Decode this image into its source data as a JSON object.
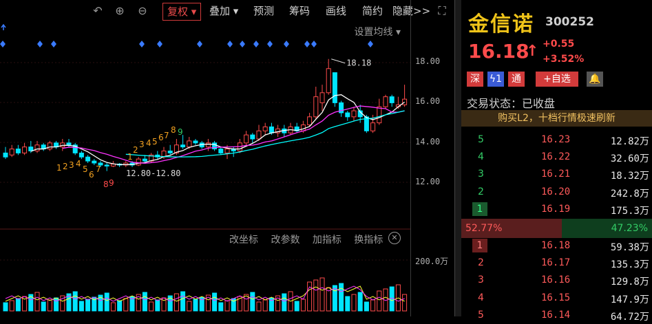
{
  "toolbar": {
    "undo_icon": "undo-icon",
    "zoom_in_icon": "zoom-in-icon",
    "zoom_out_icon": "zoom-out-icon",
    "items": [
      "复权 ▾",
      "叠加 ▾",
      "预测",
      "筹码",
      "画线",
      "简约",
      "隐藏>>"
    ],
    "fullscreen_icon": "fullscreen-icon"
  },
  "main_chart": {
    "settings_label": "设置均线 ▾",
    "annotation_high": "18.18",
    "annotation_low": "12.80-12.80",
    "price_axis": [
      "18.00",
      "16.00",
      "14.00",
      "12.00"
    ],
    "td_down": [
      "1",
      "2",
      "3",
      "4",
      "5",
      "6",
      "7",
      "8",
      "9"
    ],
    "td_up": [
      "1",
      "2",
      "3",
      "4",
      "5",
      "6",
      "7",
      "8",
      "9"
    ]
  },
  "sub_chart": {
    "tools": [
      "改坐标",
      "改参数",
      "加指标",
      "换指标"
    ],
    "close_icon": "close-icon",
    "axis_label": "200.0万"
  },
  "quote": {
    "name": "金信诺",
    "code": "300252",
    "price": "16.18",
    "arrow": "↑",
    "change": "+0.55",
    "change_pct": "+3.52%",
    "badges": [
      "深",
      "ϟ1",
      "通",
      "+自选"
    ],
    "bell_icon": "bell-icon",
    "trade_status": "交易状态：已收盘",
    "l2_banner": "购买L2，十档行情极速刷新",
    "asks": [
      {
        "level": "5",
        "price": "16.23",
        "volume": "12.82万"
      },
      {
        "level": "4",
        "price": "16.22",
        "volume": "32.60万"
      },
      {
        "level": "3",
        "price": "16.21",
        "volume": "18.32万"
      },
      {
        "level": "2",
        "price": "16.20",
        "volume": "242.8万"
      },
      {
        "level": "1",
        "price": "16.19",
        "volume": "175.3万"
      }
    ],
    "buy_ratio": "52.77%",
    "sell_ratio": "47.23%",
    "bids": [
      {
        "level": "1",
        "price": "16.18",
        "volume": "59.38万"
      },
      {
        "level": "2",
        "price": "16.17",
        "volume": "135.3万"
      },
      {
        "level": "3",
        "price": "16.16",
        "volume": "129.8万"
      },
      {
        "level": "4",
        "price": "16.15",
        "volume": "147.9万"
      },
      {
        "level": "5",
        "price": "16.14",
        "volume": "64.72万"
      }
    ]
  },
  "colors": {
    "up": "#ff4b4b",
    "down": "#00e5ff",
    "ma5": "#ffffff",
    "ma10": "#ff33ff",
    "ma20": "#00ffff",
    "name": "#f0c419"
  }
}
